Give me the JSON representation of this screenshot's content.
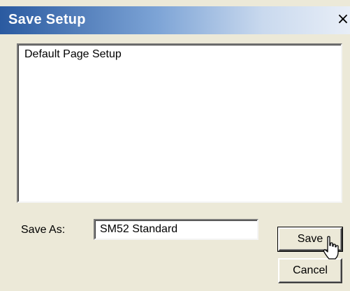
{
  "window": {
    "title": "Save Setup",
    "close_glyph": "×"
  },
  "setups_list": {
    "items": [
      "Default Page Setup"
    ]
  },
  "save_as": {
    "label": "Save As:",
    "value": "SM52 Standard"
  },
  "buttons": {
    "save_label": "Save",
    "cancel_label": "Cancel"
  },
  "icons": {
    "close": "close-icon",
    "cursor": "hand-pointer-icon"
  }
}
